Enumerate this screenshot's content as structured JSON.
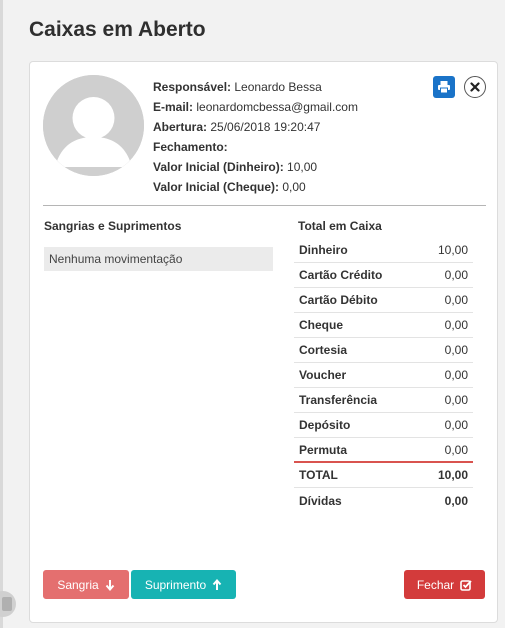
{
  "page": {
    "title": "Caixas em Aberto"
  },
  "caixa": {
    "responsavel_label": "Responsável:",
    "responsavel": "Leonardo Bessa",
    "email_label": "E-mail:",
    "email": "leonardomcbessa@gmail.com",
    "abertura_label": "Abertura:",
    "abertura": "25/06/2018 19:20:47",
    "fechamento_label": "Fechamento:",
    "fechamento": "",
    "valor_inicial_dinheiro_label": "Valor Inicial (Dinheiro):",
    "valor_inicial_dinheiro": "10,00",
    "valor_inicial_cheque_label": "Valor Inicial (Cheque):",
    "valor_inicial_cheque": "0,00"
  },
  "icons": {
    "print": "print-icon",
    "close": "close-icon"
  },
  "sangrias": {
    "title": "Sangrias e Suprimentos",
    "empty": "Nenhuma movimentação"
  },
  "totals": {
    "title": "Total em Caixa",
    "rows": [
      {
        "label": "Dinheiro",
        "value": "10,00"
      },
      {
        "label": "Cartão Crédito",
        "value": "0,00"
      },
      {
        "label": "Cartão Débito",
        "value": "0,00"
      },
      {
        "label": "Cheque",
        "value": "0,00"
      },
      {
        "label": "Cortesia",
        "value": "0,00"
      },
      {
        "label": "Voucher",
        "value": "0,00"
      },
      {
        "label": "Transferência",
        "value": "0,00"
      },
      {
        "label": "Depósito",
        "value": "0,00"
      },
      {
        "label": "Permuta",
        "value": "0,00"
      }
    ],
    "total_label": "TOTAL",
    "total_value": "10,00",
    "dividas_label": "Dívidas",
    "dividas_value": "0,00"
  },
  "buttons": {
    "sangria": "Sangria",
    "suprimento": "Suprimento",
    "fechar": "Fechar"
  },
  "colors": {
    "print": "#1a73c8",
    "sangria": "#e46f6f",
    "suprimento": "#17b3b3",
    "fechar": "#d33b3b",
    "permuta_underline": "#d9534f"
  }
}
